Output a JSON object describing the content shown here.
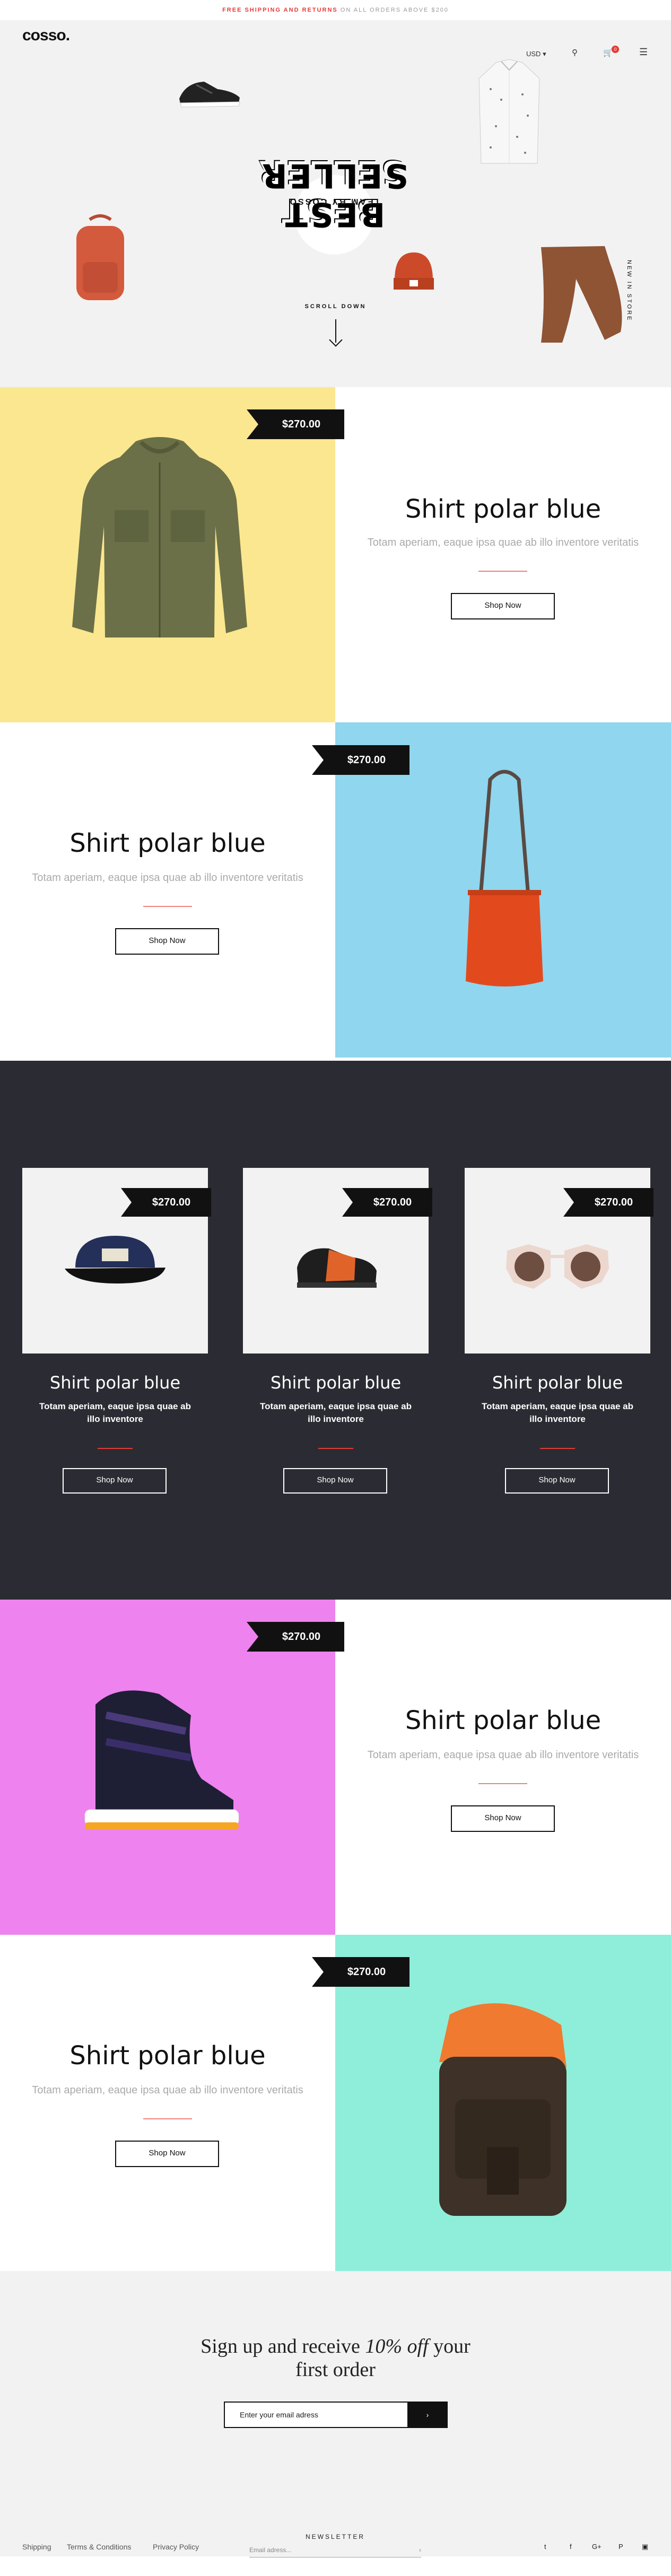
{
  "topbar": {
    "highlight": "FREE SHIPPING AND RETURNS",
    "rest": " ON ALL ORDERS ABOVE $200"
  },
  "header": {
    "logo": "cosso.",
    "currency": "USD",
    "cart_count": "0"
  },
  "hero": {
    "title": "BEST SELLER",
    "subtitle": "TEAM BY COSSO",
    "scroll_label": "SCROLL DOWN",
    "side_label": "NEW IN STORE"
  },
  "panels": [
    {
      "price": "$270.00",
      "title": "Shirt polar blue",
      "desc": "Totam aperiam, eaque ipsa quae ab illo inventore veritatis",
      "button": "Shop Now",
      "image": "jacket",
      "bg": "#fbe78f"
    },
    {
      "price": "$270.00",
      "title": "Shirt polar blue",
      "desc": "Totam aperiam, eaque ipsa quae ab illo inventore veritatis",
      "button": "Shop Now",
      "image": "bag",
      "bg": "#8fd6ee"
    },
    {
      "price": "$270.00",
      "title": "Shirt polar blue",
      "desc": "Totam aperiam, eaque ipsa quae ab illo inventore veritatis",
      "button": "Shop Now",
      "image": "sandal",
      "bg": "#ee82ee"
    },
    {
      "price": "$270.00",
      "title": "Shirt polar blue",
      "desc": "Totam aperiam, eaque ipsa quae ab illo inventore veritatis",
      "button": "Shop Now",
      "image": "backpack",
      "bg": "#8feed9"
    }
  ],
  "cards": [
    {
      "price": "$270.00",
      "title": "Shirt polar blue",
      "desc": "Totam aperiam, eaque ipsa quae ab illo inventore",
      "button": "Shop Now",
      "image": "cap"
    },
    {
      "price": "$270.00",
      "title": "Shirt polar blue",
      "desc": "Totam aperiam, eaque ipsa quae ab illo inventore",
      "button": "Shop Now",
      "image": "shoe"
    },
    {
      "price": "$270.00",
      "title": "Shirt polar blue",
      "desc": "Totam aperiam, eaque ipsa quae ab illo inventore",
      "button": "Shop Now",
      "image": "sunglasses"
    }
  ],
  "newsletter": {
    "line1a": "Sign up and receive ",
    "line1b": "10% off",
    "line1c": " your",
    "line2": "first order",
    "placeholder": "Enter your email adress",
    "submit": "›"
  },
  "footer": {
    "links": [
      "Shipping",
      "Terms & Conditions",
      "Privacy Policy"
    ],
    "newsletter_label": "NEWSLETTER",
    "email_placeholder": "Email adress...",
    "social": [
      "twitter-icon",
      "facebook-icon",
      "googleplus-icon",
      "pinterest-icon",
      "instagram-icon"
    ]
  }
}
